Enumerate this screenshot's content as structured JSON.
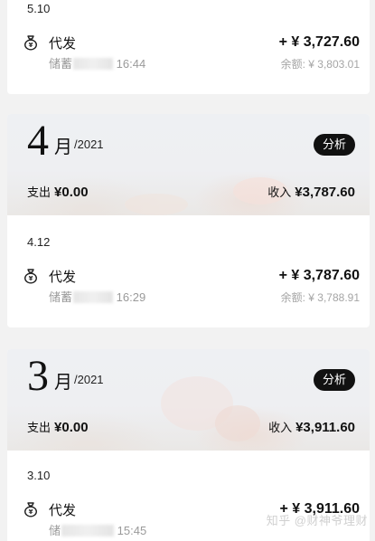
{
  "top_card": {
    "date": "5.10",
    "tx": {
      "title": "代发",
      "sub_prefix": "储蓄",
      "time": "16:44",
      "amount": "+ ¥ 3,727.60",
      "balance": "余额: ¥ 3,803.01"
    }
  },
  "april": {
    "month": "4",
    "unit": "月",
    "year": "/2021",
    "analyze_label": "分析",
    "out_label": "支出",
    "out_value": "¥0.00",
    "in_label": "收入",
    "in_value": "¥3,787.60",
    "date": "4.12",
    "tx": {
      "title": "代发",
      "sub_prefix": "储蓄",
      "time": "16:29",
      "amount": "+ ¥ 3,787.60",
      "balance": "余额: ¥ 3,788.91"
    }
  },
  "march": {
    "month": "3",
    "unit": "月",
    "year": "/2021",
    "analyze_label": "分析",
    "out_label": "支出",
    "out_value": "¥0.00",
    "in_label": "收入",
    "in_value": "¥3,911.60",
    "date": "3.10",
    "tx": {
      "title": "代发",
      "sub_prefix": "储",
      "time": "15:45",
      "amount": "+ ¥ 3,911.60"
    }
  },
  "watermark": "知乎 @财神爷理财"
}
